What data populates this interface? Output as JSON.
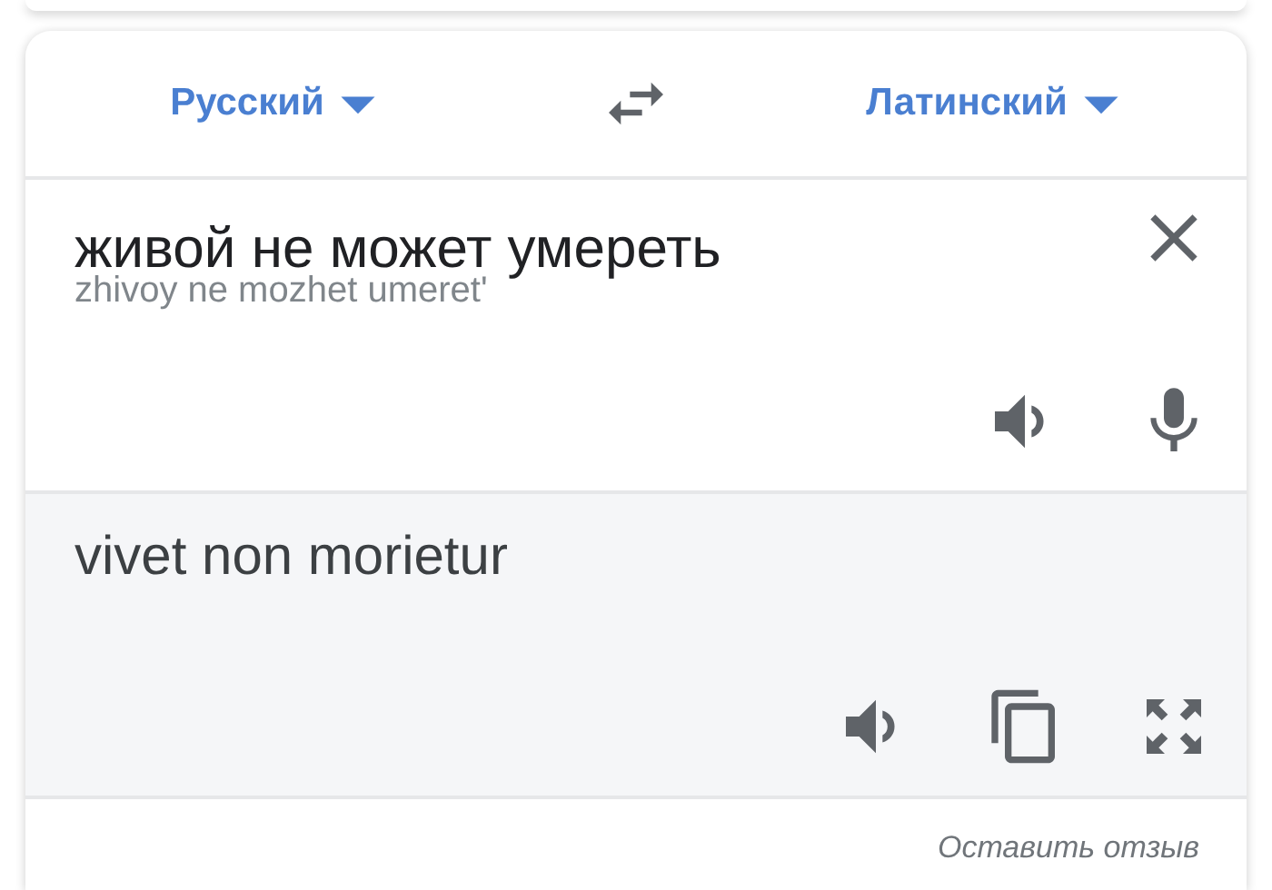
{
  "languages": {
    "source": {
      "label": "Русский"
    },
    "target": {
      "label": "Латинский"
    }
  },
  "input": {
    "text": "живой не может умереть",
    "transliteration": "zhivoy ne mozhet umeret'"
  },
  "output": {
    "text": "vivet non morietur"
  },
  "feedback_link": "Оставить отзыв"
}
